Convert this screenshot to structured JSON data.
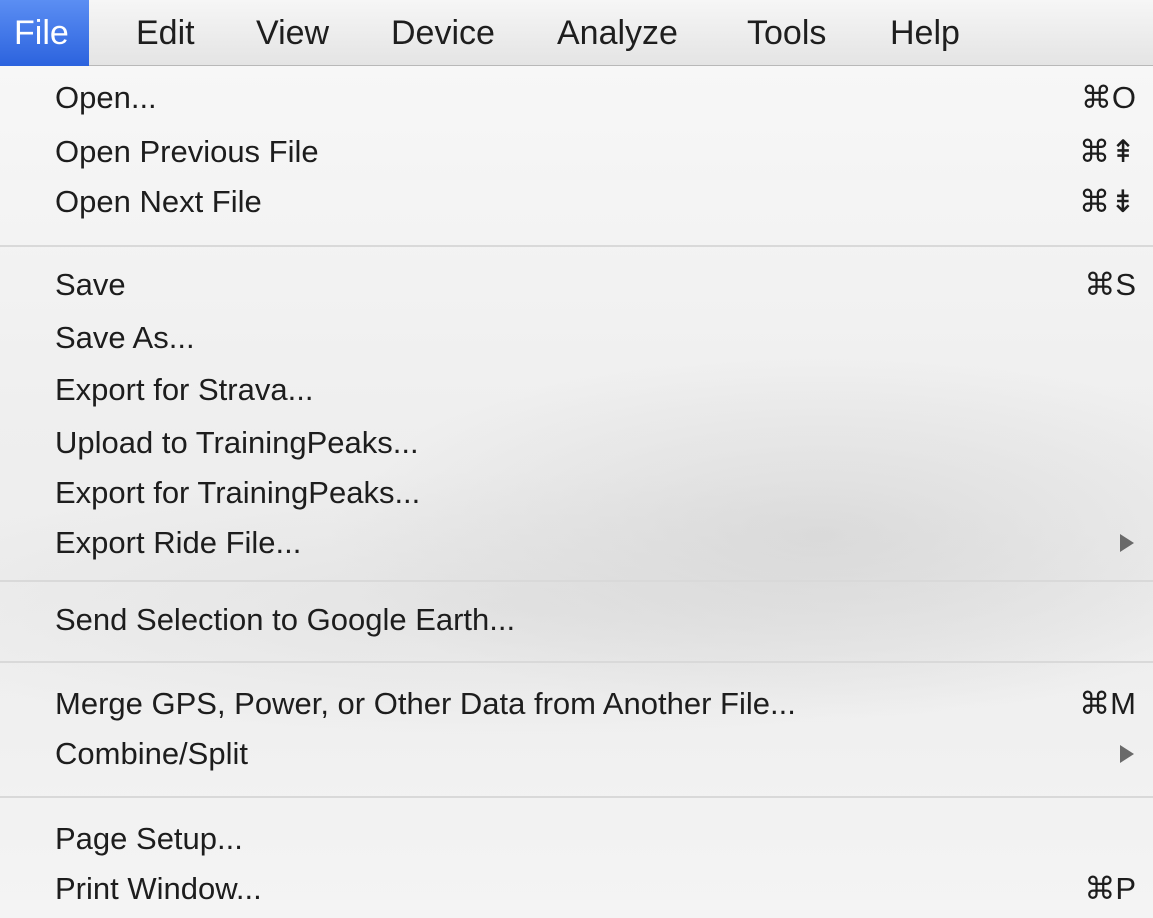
{
  "menubar": {
    "items": [
      {
        "label": "File",
        "active": true
      },
      {
        "label": "Edit"
      },
      {
        "label": "View"
      },
      {
        "label": "Device"
      },
      {
        "label": "Analyze"
      },
      {
        "label": "Tools"
      },
      {
        "label": "Help"
      }
    ]
  },
  "file_menu": {
    "open": {
      "label": "Open...",
      "shortcut": "⌘O"
    },
    "open_previous": {
      "label": "Open Previous File",
      "shortcut": "⌘⇞"
    },
    "open_next": {
      "label": "Open Next File",
      "shortcut": "⌘⇟"
    },
    "save": {
      "label": "Save",
      "shortcut": "⌘S"
    },
    "save_as": {
      "label": "Save As..."
    },
    "export_strava": {
      "label": "Export for Strava..."
    },
    "upload_trainingpeaks": {
      "label": "Upload to TrainingPeaks..."
    },
    "export_trainingpeaks": {
      "label": "Export for TrainingPeaks..."
    },
    "export_ride_file": {
      "label": "Export Ride File...",
      "submenu_icon": "triangle-right-icon"
    },
    "send_google_earth": {
      "label": "Send Selection to Google Earth..."
    },
    "merge_data": {
      "label": "Merge GPS, Power, or Other Data from Another File...",
      "shortcut": "⌘M"
    },
    "combine_split": {
      "label": "Combine/Split",
      "submenu_icon": "triangle-right-icon"
    },
    "page_setup": {
      "label": "Page Setup..."
    },
    "print_window": {
      "label": "Print Window...",
      "shortcut": "⌘P"
    }
  },
  "colors": {
    "active_menu": "#3a72e8",
    "menu_background": "#f2f2f2",
    "separator": "#d9d9d9"
  }
}
